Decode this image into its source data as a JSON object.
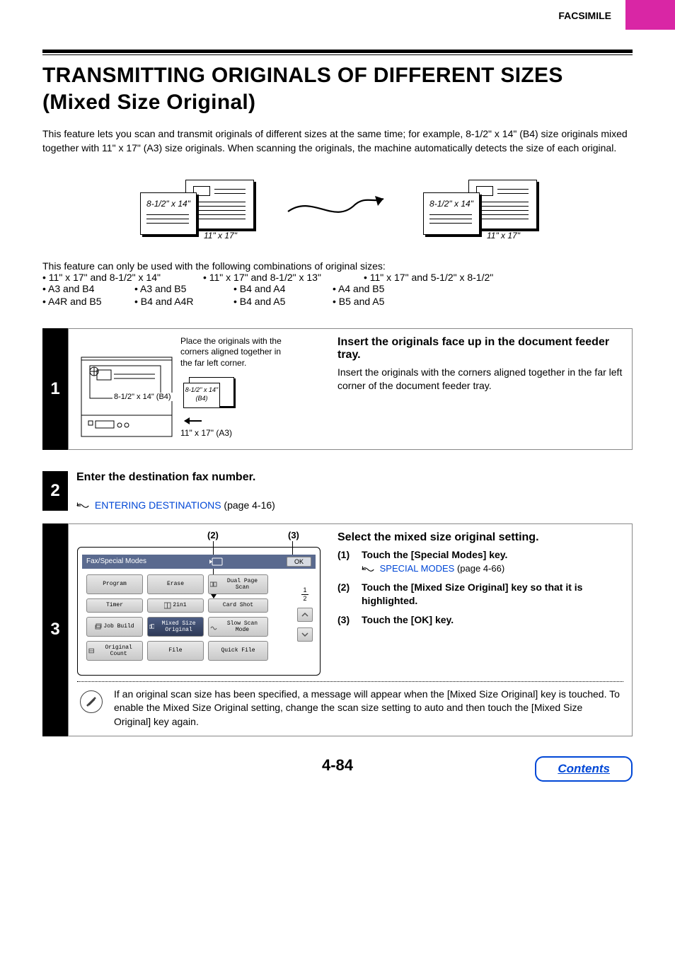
{
  "header": {
    "section": "FACSIMILE"
  },
  "title": "TRANSMITTING ORIGINALS OF DIFFERENT SIZES (Mixed Size Original)",
  "intro": "This feature lets you scan and transmit originals of different sizes at the same time; for example, 8-1/2\" x 14\" (B4) size originals mixed together with 11\" x 17\" (A3) size originals. When scanning the originals, the machine automatically detects the size of each original.",
  "diagram": {
    "size_a": "8-1/2\" x 14\"",
    "size_b": "11\" x 17\""
  },
  "combos_intro": "This feature can only be used with the following combinations of original sizes:",
  "combos_row1": [
    "• 11\" x 17\" and 8-1/2\" x 14\"",
    "• 11\" x 17\" and 8-1/2\" x 13\"",
    "• 11\" x 17\" and 5-1/2\" x 8-1/2\""
  ],
  "combos_row2": [
    "• A3 and B4",
    "• A3 and B5",
    "• B4 and A4",
    "• A4 and B5"
  ],
  "combos_row3": [
    "• A4R and B5",
    "• B4 and A4R",
    "• B4 and A5",
    "• B5 and A5"
  ],
  "step1": {
    "num": "1",
    "caption": "Place the originals with the corners aligned together in the far left corner.",
    "label_b4": "8-1/2\" x 14\" (B4)",
    "label_b4_italic": "8-1/2\" x 14\" (B4)",
    "label_a3": "11\" x 17\" (A3)",
    "heading": "Insert the originals face up in the document feeder tray.",
    "body": "Insert the originals with the corners aligned together in the far left corner of the document feeder tray."
  },
  "step2": {
    "num": "2",
    "heading": "Enter the destination fax number.",
    "link_text": "ENTERING DESTINATIONS",
    "link_suffix": " (page 4-16)"
  },
  "step3": {
    "num": "3",
    "callout2": "(2)",
    "callout3": "(3)",
    "panel": {
      "title": "Fax/Special Modes",
      "ok": "OK",
      "buttons": {
        "program": "Program",
        "erase": "Erase",
        "dual_page": "Dual Page Scan",
        "timer": "Timer",
        "two_in_one": "2in1",
        "card_shot": "Card Shot",
        "job_build": "Job Build",
        "mixed": "Mixed Size Original",
        "slow_scan": "Slow Scan Mode",
        "orig_count": "Original Count",
        "file": "File",
        "quick_file": "Quick File"
      },
      "page_indicator_top": "1",
      "page_indicator_bot": "2"
    },
    "heading": "Select the mixed size original setting.",
    "items": [
      {
        "num": "(1)",
        "text": "Touch the [Special Modes] key.",
        "link": "SPECIAL MODES",
        "link_suffix": " (page 4-66)"
      },
      {
        "num": "(2)",
        "text": "Touch the [Mixed Size Original] key so that it is highlighted."
      },
      {
        "num": "(3)",
        "text": "Touch the [OK] key."
      }
    ],
    "note": "If an original scan size has been specified, a message will appear when the [Mixed Size Original] key is touched. To enable the Mixed Size Original setting, change the scan size setting to auto and then touch the [Mixed Size Original] key again."
  },
  "page_number": "4-84",
  "contents_label": "Contents"
}
